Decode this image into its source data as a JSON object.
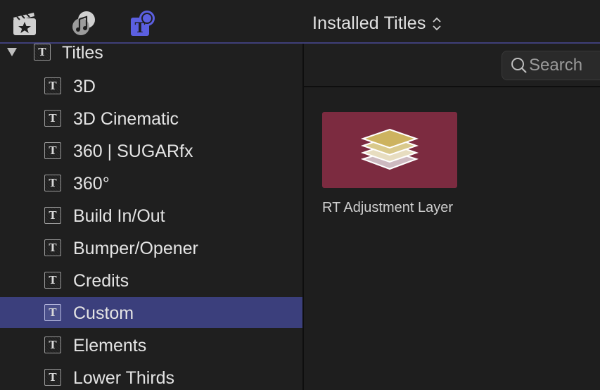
{
  "toolbar": {
    "icons": [
      "photos-video-icon",
      "music-sound-icon",
      "titles-generators-icon"
    ],
    "header_title": "Installed Titles"
  },
  "sidebar": {
    "root": {
      "label": "Titles",
      "expanded": true
    },
    "items": [
      {
        "label": "3D",
        "selected": false
      },
      {
        "label": "3D Cinematic",
        "selected": false
      },
      {
        "label": "360 | SUGARfx",
        "selected": false
      },
      {
        "label": "360°",
        "selected": false
      },
      {
        "label": "Build In/Out",
        "selected": false
      },
      {
        "label": "Bumper/Opener",
        "selected": false
      },
      {
        "label": "Credits",
        "selected": false
      },
      {
        "label": "Custom",
        "selected": true
      },
      {
        "label": "Elements",
        "selected": false
      },
      {
        "label": "Lower Thirds",
        "selected": false
      }
    ]
  },
  "search": {
    "placeholder": "Search",
    "value": ""
  },
  "browser": {
    "items": [
      {
        "name": "RT Adjustment Layer",
        "thumbnail_color": "#7c2b40"
      }
    ]
  },
  "colors": {
    "selection": "#3b3f7c",
    "accent": "#5b5fe0",
    "background": "#1f1f1f"
  }
}
